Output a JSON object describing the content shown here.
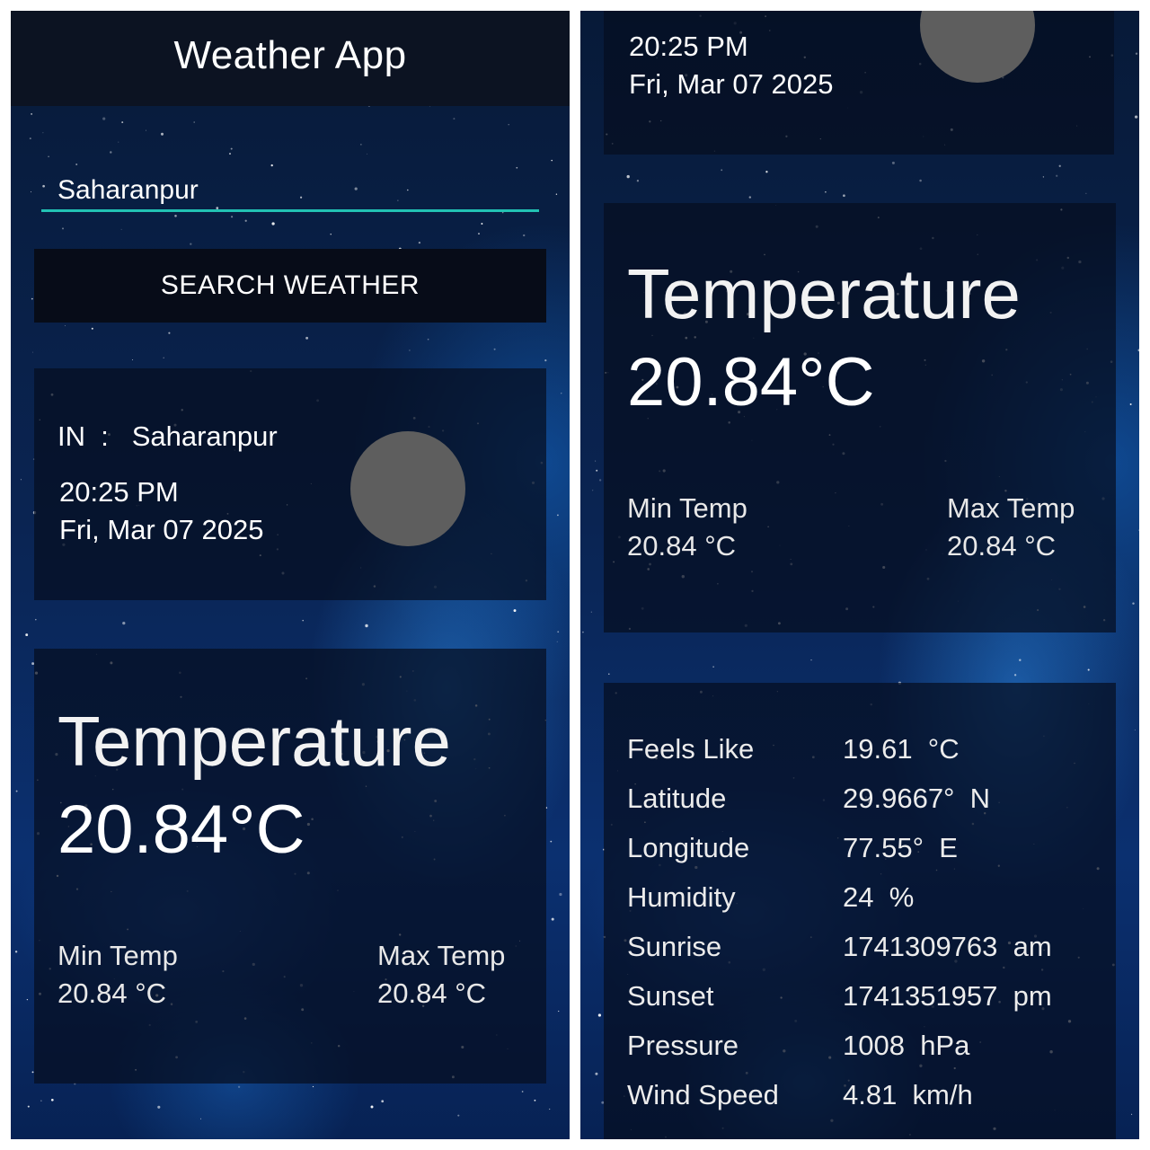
{
  "app": {
    "title": "Weather App"
  },
  "search": {
    "value": "Saharanpur",
    "button_label": "SEARCH WEATHER"
  },
  "location": {
    "country": "IN",
    "separator": ":",
    "city": "Saharanpur",
    "time": "20:25 PM",
    "date": "Fri, Mar 07 2025"
  },
  "temperature": {
    "title": "Temperature",
    "value": "20.84°C",
    "min_label": "Min Temp",
    "min_value": "20.84 °C",
    "max_label": "Max Temp",
    "max_value": "20.84 °C"
  },
  "details": [
    {
      "label": "Feels Like",
      "value": "19.61  °C"
    },
    {
      "label": "Latitude",
      "value": "29.9667°  N"
    },
    {
      "label": "Longitude",
      "value": "77.55°  E"
    },
    {
      "label": "Humidity",
      "value": "24  %"
    },
    {
      "label": "Sunrise",
      "value": "1741309763  am"
    },
    {
      "label": "Sunset",
      "value": "1741351957  pm"
    },
    {
      "label": "Pressure",
      "value": "1008  hPa"
    },
    {
      "label": "Wind Speed",
      "value": "4.81  km/h"
    }
  ],
  "colors": {
    "accent": "#22c2b3",
    "icon_placeholder": "#5e5e5e",
    "appbar": "#0c1322"
  },
  "icons": {
    "weather": "weather-icon-placeholder"
  }
}
